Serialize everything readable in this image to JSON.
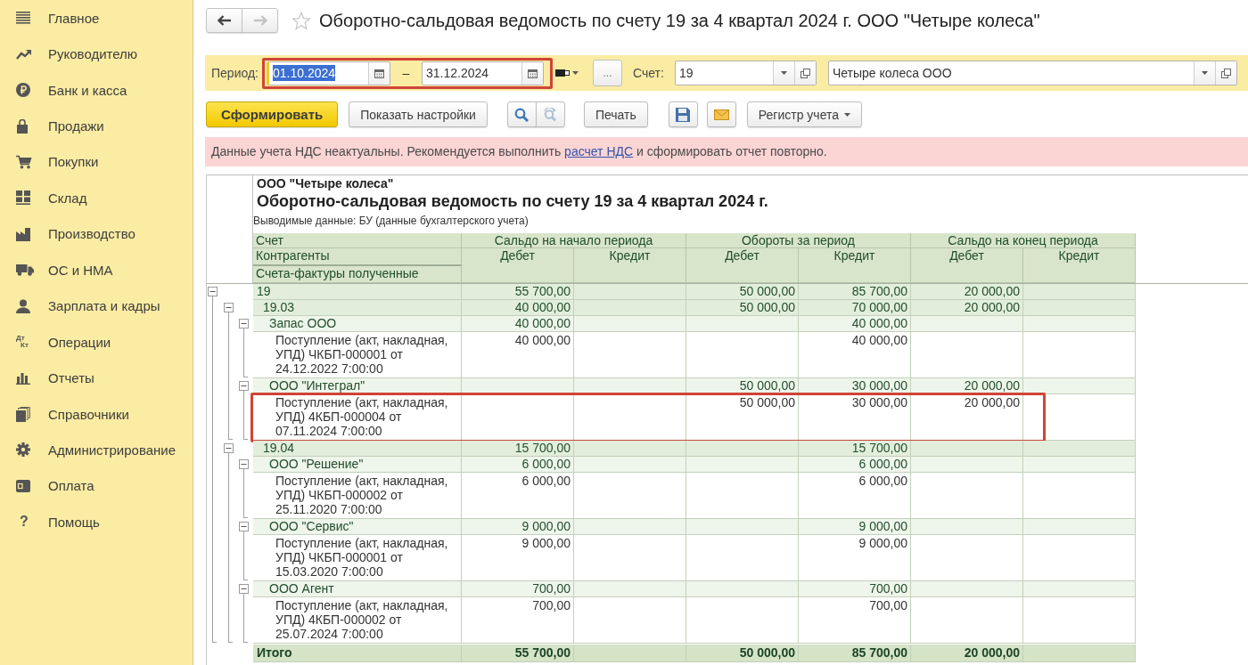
{
  "sidebar": {
    "items": [
      {
        "label": "Главное"
      },
      {
        "label": "Руководителю"
      },
      {
        "label": "Банк и касса"
      },
      {
        "label": "Продажи"
      },
      {
        "label": "Покупки"
      },
      {
        "label": "Склад"
      },
      {
        "label": "Производство"
      },
      {
        "label": "ОС и НМА"
      },
      {
        "label": "Зарплата и кадры"
      },
      {
        "label": "Операции",
        "icon_text": [
          "Дт",
          "Кт"
        ]
      },
      {
        "label": "Отчеты"
      },
      {
        "label": "Справочники"
      },
      {
        "label": "Администрирование"
      },
      {
        "label": "Оплата"
      },
      {
        "label": "Помощь",
        "icon_text": [
          "?"
        ]
      }
    ]
  },
  "header": {
    "nav": [
      {
        "kind": "back",
        "disabled": false
      },
      {
        "kind": "forward",
        "disabled": true
      }
    ],
    "starred": false,
    "title": "Оборотно-сальдовая ведомость по счету 19 за 4 квартал 2024 г. ООО \"Четыре колеса\""
  },
  "filter": {
    "period_label": "Период:",
    "period": {
      "highlighted": true,
      "separator": "–",
      "dates": [
        {
          "value": "01.10.2024",
          "focused": true
        },
        {
          "value": "31.12.2024",
          "focused": false
        }
      ]
    },
    "more_button": "...",
    "account_label": "Счет:",
    "account": {
      "value": "19"
    },
    "organization": {
      "value": "Четыре колеса ООО"
    }
  },
  "toolbar": [
    {
      "kind": "primary",
      "label": "Сформировать",
      "disabled": false
    },
    {
      "kind": "button",
      "label": "Показать настройки",
      "disabled": false
    },
    {
      "kind": "search",
      "disabled": false
    },
    {
      "kind": "search_next",
      "disabled": true
    },
    {
      "kind": "button",
      "label": "Печать",
      "disabled": false
    },
    {
      "kind": "save",
      "disabled": false
    },
    {
      "kind": "mail",
      "disabled": false
    },
    {
      "kind": "menu",
      "label": "Регистр учета",
      "disabled": false
    }
  ],
  "warning": {
    "before": "Данные учета НДС неактуальны. Рекомендуется выполнить",
    "link": "расчет НДС",
    "after": "и сформировать отчет повторно."
  },
  "report": {
    "organization": "ООО \"Четыре колеса\"",
    "title": "Оборотно-сальдовая ведомость по счету 19 за 4 квартал 2024 г.",
    "note": "Выводимые данные: БУ (данные бухгалтерского учета)",
    "row_headers": [
      "Счет",
      "Контрагенты",
      "Счета-фактуры полученные"
    ],
    "column_groups": [
      {
        "label": "Сальдо на начало периода",
        "columns": [
          "Дебет",
          "Кредит"
        ]
      },
      {
        "label": "Обороты за период",
        "columns": [
          "Дебет",
          "Кредит"
        ]
      },
      {
        "label": "Сальдо на конец периода",
        "columns": [
          "Дебет",
          "Кредит"
        ]
      }
    ],
    "rows": [
      {
        "kind": "account",
        "label": "19",
        "expanded": true,
        "highlighted": false,
        "values": {
          "opening_debit": "55 700,00",
          "turnover_debit": "50 000,00",
          "turnover_credit": "85 700,00",
          "closing_debit": "20 000,00"
        },
        "children": [
          {
            "kind": "account",
            "label": "19.03",
            "expanded": true,
            "highlighted": false,
            "values": {
              "opening_debit": "40 000,00",
              "turnover_debit": "50 000,00",
              "turnover_credit": "70 000,00",
              "closing_debit": "20 000,00"
            },
            "children": [
              {
                "kind": "counterparty",
                "label": "Запас ООО",
                "expanded": true,
                "highlighted": false,
                "values": {
                  "opening_debit": "40 000,00",
                  "turnover_credit": "40 000,00"
                },
                "children": [
                  {
                    "kind": "document",
                    "label": "Поступление (акт, накладная, УПД) ЧКБП-000001 от 24.12.2022 7:00:00",
                    "highlighted": false,
                    "values": {
                      "opening_debit": "40 000,00",
                      "turnover_credit": "40 000,00"
                    }
                  }
                ]
              },
              {
                "kind": "counterparty",
                "label": "ООО \"Интеграл\"",
                "expanded": true,
                "highlighted": false,
                "values": {
                  "turnover_debit": "50 000,00",
                  "turnover_credit": "30 000,00",
                  "closing_debit": "20 000,00"
                },
                "children": [
                  {
                    "kind": "document",
                    "label": "Поступление (акт, накладная, УПД) 4КБП-000004 от 07.11.2024 7:00:00",
                    "highlighted": true,
                    "values": {
                      "turnover_debit": "50 000,00",
                      "turnover_credit": "30 000,00",
                      "closing_debit": "20 000,00"
                    }
                  }
                ]
              }
            ]
          },
          {
            "kind": "account",
            "label": "19.04",
            "expanded": true,
            "highlighted": false,
            "values": {
              "opening_debit": "15 700,00",
              "turnover_credit": "15 700,00"
            },
            "children": [
              {
                "kind": "counterparty",
                "label": "ООО \"Решение\"",
                "expanded": true,
                "highlighted": false,
                "values": {
                  "opening_debit": "6 000,00",
                  "turnover_credit": "6 000,00"
                },
                "children": [
                  {
                    "kind": "document",
                    "label": "Поступление (акт, накладная, УПД) ЧКБП-000002 от 25.11.2020 7:00:00",
                    "highlighted": false,
                    "values": {
                      "opening_debit": "6 000,00",
                      "turnover_credit": "6 000,00"
                    }
                  }
                ]
              },
              {
                "kind": "counterparty",
                "label": "ООО \"Сервис\"",
                "expanded": true,
                "highlighted": false,
                "values": {
                  "opening_debit": "9 000,00",
                  "turnover_credit": "9 000,00"
                },
                "children": [
                  {
                    "kind": "document",
                    "label": "Поступление (акт, накладная, УПД) ЧКБП-000001 от 15.03.2020 7:00:00",
                    "highlighted": false,
                    "values": {
                      "opening_debit": "9 000,00",
                      "turnover_credit": "9 000,00"
                    }
                  }
                ]
              },
              {
                "kind": "counterparty",
                "label": "ООО Агент",
                "expanded": true,
                "highlighted": false,
                "values": {
                  "opening_debit": "700,00",
                  "turnover_credit": "700,00"
                },
                "children": [
                  {
                    "kind": "document",
                    "label": "Поступление (акт, накладная, УПД) 4КБП-000002 от 25.07.2024 7:00:00",
                    "highlighted": false,
                    "values": {
                      "opening_debit": "700,00",
                      "turnover_credit": "700,00"
                    }
                  }
                ]
              }
            ]
          }
        ]
      }
    ],
    "total": {
      "label": "Итого",
      "values": {
        "opening_debit": "55 700,00",
        "turnover_debit": "50 000,00",
        "turnover_credit": "85 700,00",
        "closing_debit": "20 000,00"
      }
    }
  }
}
